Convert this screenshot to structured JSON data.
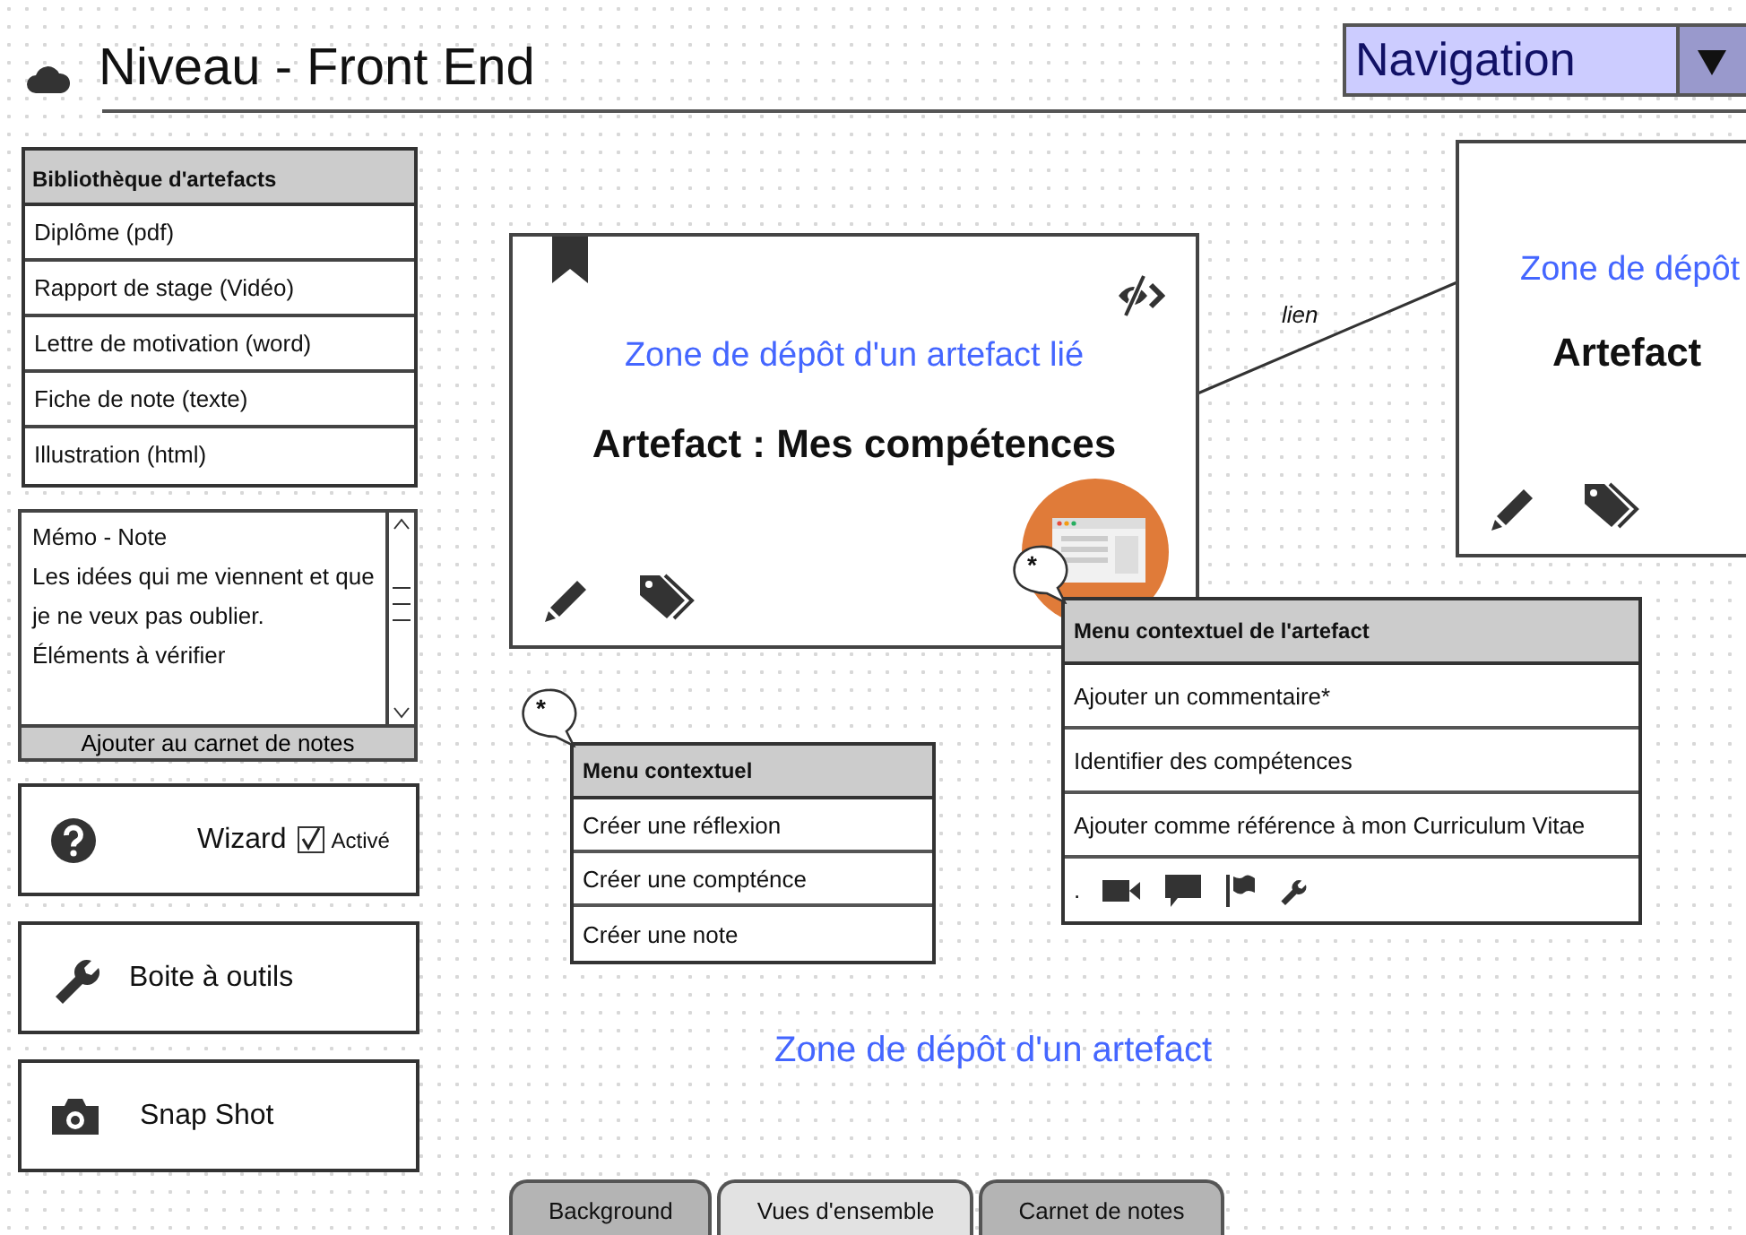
{
  "header": {
    "title": "Niveau - Front End",
    "navigation": "Navigation"
  },
  "library": {
    "title": "Bibliothèque d'artefacts",
    "items": [
      "Diplôme (pdf)",
      "Rapport de stage (Vidéo)",
      "Lettre de motivation (word)",
      "Fiche de note (texte)",
      "Illustration (html)"
    ]
  },
  "memo": {
    "lines": [
      "Mémo - Note",
      "Les idées qui me viennent et que",
      "je ne veux pas oublier.",
      "Éléments à vérifier"
    ],
    "button": "Ajouter au carnet de notes"
  },
  "panels": [
    {
      "kind": "wizard",
      "label": "Wizard",
      "checkbox": {
        "label": "Activé",
        "checked": true
      }
    },
    {
      "kind": "toolbox",
      "label": "Boite à outils"
    },
    {
      "kind": "camera",
      "label": "Snap Shot"
    }
  ],
  "linked_card": {
    "zone": "Zone de dépôt d'un artefact lié",
    "title": "Artefact : Mes compétences"
  },
  "link_label": "lien",
  "target_card": {
    "zone": "Zone de dépôt",
    "title": "Artefact"
  },
  "context_menu": {
    "marker": "*",
    "title": "Menu contextuel",
    "items": [
      "Créer une réflexion",
      "Créer une compténce",
      "Créer une note"
    ]
  },
  "artefact_menu": {
    "marker": "*",
    "title": "Menu contextuel de l'artefact",
    "items": [
      "Ajouter un commentaire*",
      "Identifier des compétences",
      "Ajouter comme référence à mon Curriculum Vitae"
    ],
    "toolbar_text": "."
  },
  "drop_zone": "Zone de dépôt d'un artefact",
  "tabs": [
    {
      "label": "Background",
      "selected": false
    },
    {
      "label": "Vues d'ensemble",
      "selected": true
    },
    {
      "label": "Carnet de notes",
      "selected": false
    }
  ]
}
